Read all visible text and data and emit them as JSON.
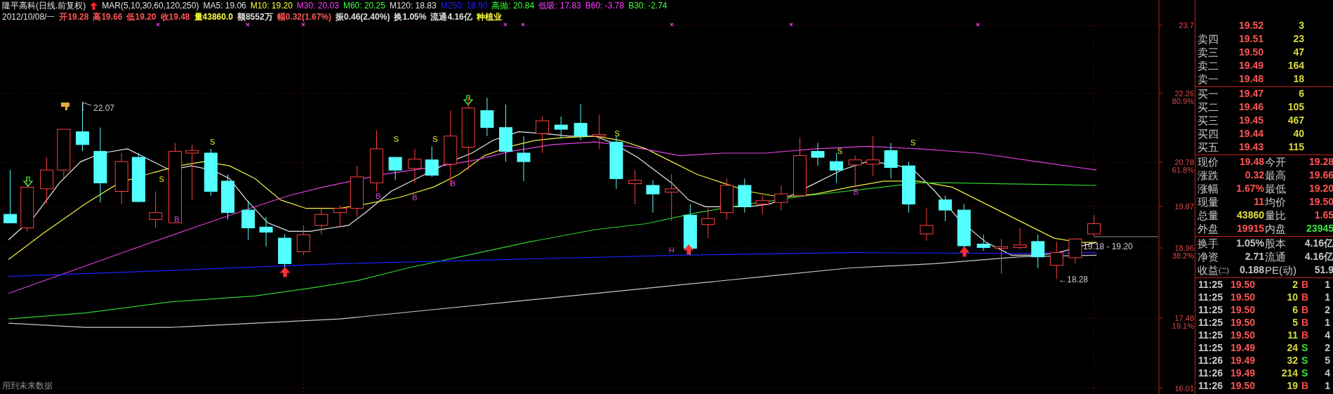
{
  "header": {
    "title": "隆平高科(日线.前复权)",
    "indicator": "MAR(5,10,30,60,120,250)",
    "legend": [
      {
        "text": "MA5: 19.06",
        "color": "#e0e0e0"
      },
      {
        "text": "M10: 19.20",
        "color": "#ffff40"
      },
      {
        "text": "M30: 20.03",
        "color": "#ff40ff"
      },
      {
        "text": "M60: 20.25",
        "color": "#40ff40"
      },
      {
        "text": "M120: 18.83",
        "color": "#e0e0e0"
      },
      {
        "text": "M250: 18.90",
        "color": "#2020ff"
      },
      {
        "text": "高抛: 20.84",
        "color": "#40ff40"
      },
      {
        "text": "低吸: 17.83",
        "color": "#ff40ff"
      },
      {
        "text": "B60: -3.78",
        "color": "#ff40ff"
      },
      {
        "text": "B30: -2.74",
        "color": "#40ff40"
      }
    ]
  },
  "bar_info": {
    "date": "2012/10/08/一",
    "fields": [
      {
        "text": "开19.28",
        "color": "#ff5454"
      },
      {
        "text": "高19.66",
        "color": "#ff5454"
      },
      {
        "text": "低19.20",
        "color": "#ff5454"
      },
      {
        "text": "收19.48",
        "color": "#ff5454"
      },
      {
        "text": "量43860.0",
        "color": "#ffff40"
      },
      {
        "text": "额8552万",
        "color": "#e0e0e0"
      },
      {
        "text": "幅0.32(1.67%)",
        "color": "#ff5454"
      },
      {
        "text": "振0.46(2.40%)",
        "color": "#e0e0e0"
      },
      {
        "text": "换1.05%",
        "color": "#e0e0e0"
      },
      {
        "text": "流通4.16亿",
        "color": "#e0e0e0"
      },
      {
        "text": "种植业",
        "color": "#ffff40"
      }
    ]
  },
  "chart": {
    "price_axis": [
      {
        "price": "23.7"
      },
      {
        "price": "22.26",
        "percent": "80.9%"
      },
      {
        "price": "20.78",
        "percent": "61.8%"
      },
      {
        "price": "19.87"
      },
      {
        "price": "18.96",
        "percent": "38.2%"
      },
      {
        "price": "17.48",
        "percent": "19.1%"
      },
      {
        "price": "16.01"
      }
    ],
    "annotations": [
      {
        "kind": "high",
        "text": "22.07"
      },
      {
        "kind": "range",
        "text": "19.18 - 19.20"
      },
      {
        "kind": "low",
        "text": "←18.28"
      }
    ],
    "signals": [
      {
        "kind": "sell",
        "text": "S"
      },
      {
        "kind": "buy",
        "text": "B"
      },
      {
        "kind": "sell",
        "text": "S"
      },
      {
        "kind": "buy",
        "text": "B"
      },
      {
        "kind": "sell",
        "text": "S"
      },
      {
        "kind": "buy",
        "text": "B"
      },
      {
        "kind": "sell",
        "text": "S"
      },
      {
        "kind": "buy",
        "text": "B"
      },
      {
        "kind": "sell",
        "text": "S"
      },
      {
        "kind": "hold",
        "text": "H"
      },
      {
        "kind": "sell",
        "text": "S"
      },
      {
        "kind": "buy",
        "text": "B"
      },
      {
        "kind": "sell",
        "text": "S"
      }
    ],
    "footnote": "用到未来数据"
  },
  "order_book": {
    "sell": [
      {
        "price": "19.52",
        "volume": "3"
      },
      {
        "label": "卖四",
        "price": "19.51",
        "volume": "23"
      },
      {
        "label": "卖三",
        "price": "19.50",
        "volume": "47"
      },
      {
        "label": "卖二",
        "price": "19.49",
        "volume": "164"
      },
      {
        "label": "卖一",
        "price": "19.48",
        "volume": "18"
      }
    ],
    "buy": [
      {
        "label": "买一",
        "price": "19.47",
        "volume": "6"
      },
      {
        "label": "买二",
        "price": "19.46",
        "volume": "105"
      },
      {
        "label": "买三",
        "price": "19.45",
        "volume": "467"
      },
      {
        "label": "买四",
        "price": "19.44",
        "volume": "40"
      },
      {
        "label": "买五",
        "price": "19.43",
        "volume": "115"
      }
    ]
  },
  "quote": [
    {
      "label": "现价",
      "value": "19.48",
      "color": "#ff5454"
    },
    {
      "label": "今开",
      "value": "19.28",
      "color": "#ff5454"
    },
    {
      "label": "涨跌",
      "value": "0.32",
      "color": "#ff5454"
    },
    {
      "label": "最高",
      "value": "19.66",
      "color": "#ff5454"
    },
    {
      "label": "涨幅",
      "value": "1.67%",
      "color": "#ff5454"
    },
    {
      "label": "最低",
      "value": "19.20",
      "color": "#ff5454"
    },
    {
      "label": "现量",
      "value": "11",
      "color": "#ff5454"
    },
    {
      "label": "均价",
      "value": "19.50",
      "color": "#ff5454"
    },
    {
      "label": "总量",
      "value": "43860",
      "color": "#e0e040"
    },
    {
      "label": "量比",
      "value": "1.65",
      "color": "#ff5454"
    },
    {
      "label": "外盘",
      "value": "19915",
      "color": "#ff5454"
    },
    {
      "label": "内盘",
      "value": "23945",
      "color": "#40e040"
    }
  ],
  "fundamentals": [
    {
      "label": "换手",
      "value": "1.05%",
      "label2": "股本",
      "value2": "4.16亿"
    },
    {
      "label": "净资",
      "value": "2.71",
      "label2": "流通",
      "value2": "4.16亿"
    },
    {
      "label": "收益㈡",
      "value": "0.188",
      "label2": "PE(动)",
      "value2": "51.9"
    }
  ],
  "trades": [
    {
      "time": "11:25",
      "price": "19.50",
      "volume": "2",
      "side": "B",
      "kind": "buy",
      "count": "1"
    },
    {
      "time": "11:25",
      "price": "19.50",
      "volume": "10",
      "side": "B",
      "kind": "buy",
      "count": "1"
    },
    {
      "time": "11:25",
      "price": "19.50",
      "volume": "6",
      "side": "B",
      "kind": "buy",
      "count": "2"
    },
    {
      "time": "11:25",
      "price": "19.50",
      "volume": "5",
      "side": "B",
      "kind": "buy",
      "count": "1"
    },
    {
      "time": "11:25",
      "price": "19.50",
      "volume": "11",
      "side": "B",
      "kind": "buy",
      "count": "4"
    },
    {
      "time": "11:25",
      "price": "19.49",
      "volume": "24",
      "side": "S",
      "kind": "sell",
      "count": "2"
    },
    {
      "time": "11:26",
      "price": "19.49",
      "volume": "32",
      "side": "S",
      "kind": "sell",
      "count": "5"
    },
    {
      "time": "11:26",
      "price": "19.49",
      "volume": "214",
      "side": "S",
      "kind": "sell",
      "count": "4"
    },
    {
      "time": "11:26",
      "price": "19.50",
      "volume": "19",
      "side": "B",
      "kind": "buy",
      "count": "1"
    }
  ]
}
